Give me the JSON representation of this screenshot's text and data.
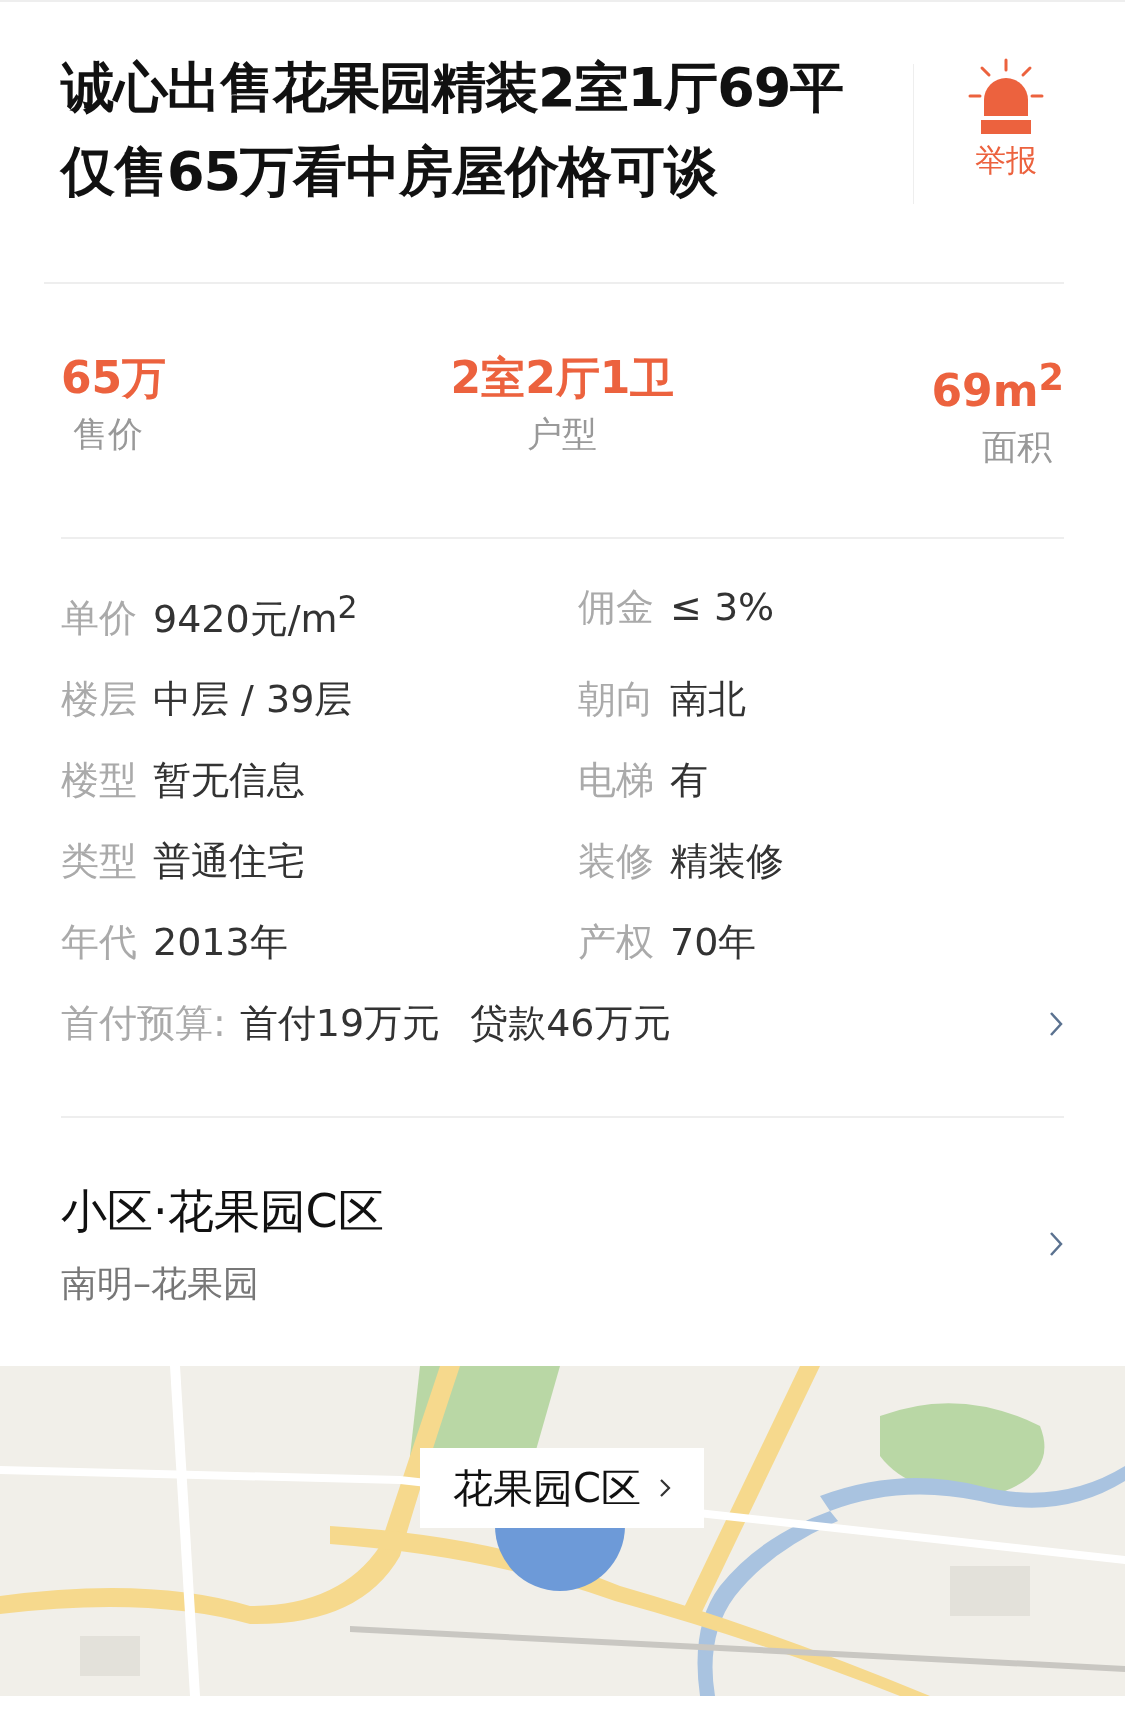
{
  "title": "诚心出售花果园精装2室1厅69平仅售65万看中房屋价格可谈",
  "report": {
    "label": "举报"
  },
  "stats": [
    {
      "value": "65万",
      "label": "售价"
    },
    {
      "value": "2室2厅1卫",
      "label": "户型"
    },
    {
      "value": "69m$^{2}$",
      "label": "面积"
    }
  ],
  "details": [
    {
      "label": "单价",
      "value": "9420元/m$^{2}$"
    },
    {
      "label": "佣金",
      "value": "≤ 3%"
    },
    {
      "label": "楼层",
      "value": "中层 / 39层"
    },
    {
      "label": "朝向",
      "value": "南北"
    },
    {
      "label": "楼型",
      "value": "暂无信息"
    },
    {
      "label": "电梯",
      "value": "有"
    },
    {
      "label": "类型",
      "value": "普通住宅"
    },
    {
      "label": "装修",
      "value": "精装修"
    },
    {
      "label": "年代",
      "value": "2013年"
    },
    {
      "label": "产权",
      "value": "70年"
    }
  ],
  "budget": {
    "label": "首付预算:",
    "down_payment": "首付19万元",
    "loan": "贷款46万元"
  },
  "community": {
    "name": "小区·花果园C区",
    "area": "南明–花果园"
  },
  "map": {
    "kind": "picture",
    "callout": "花果园C区"
  }
}
